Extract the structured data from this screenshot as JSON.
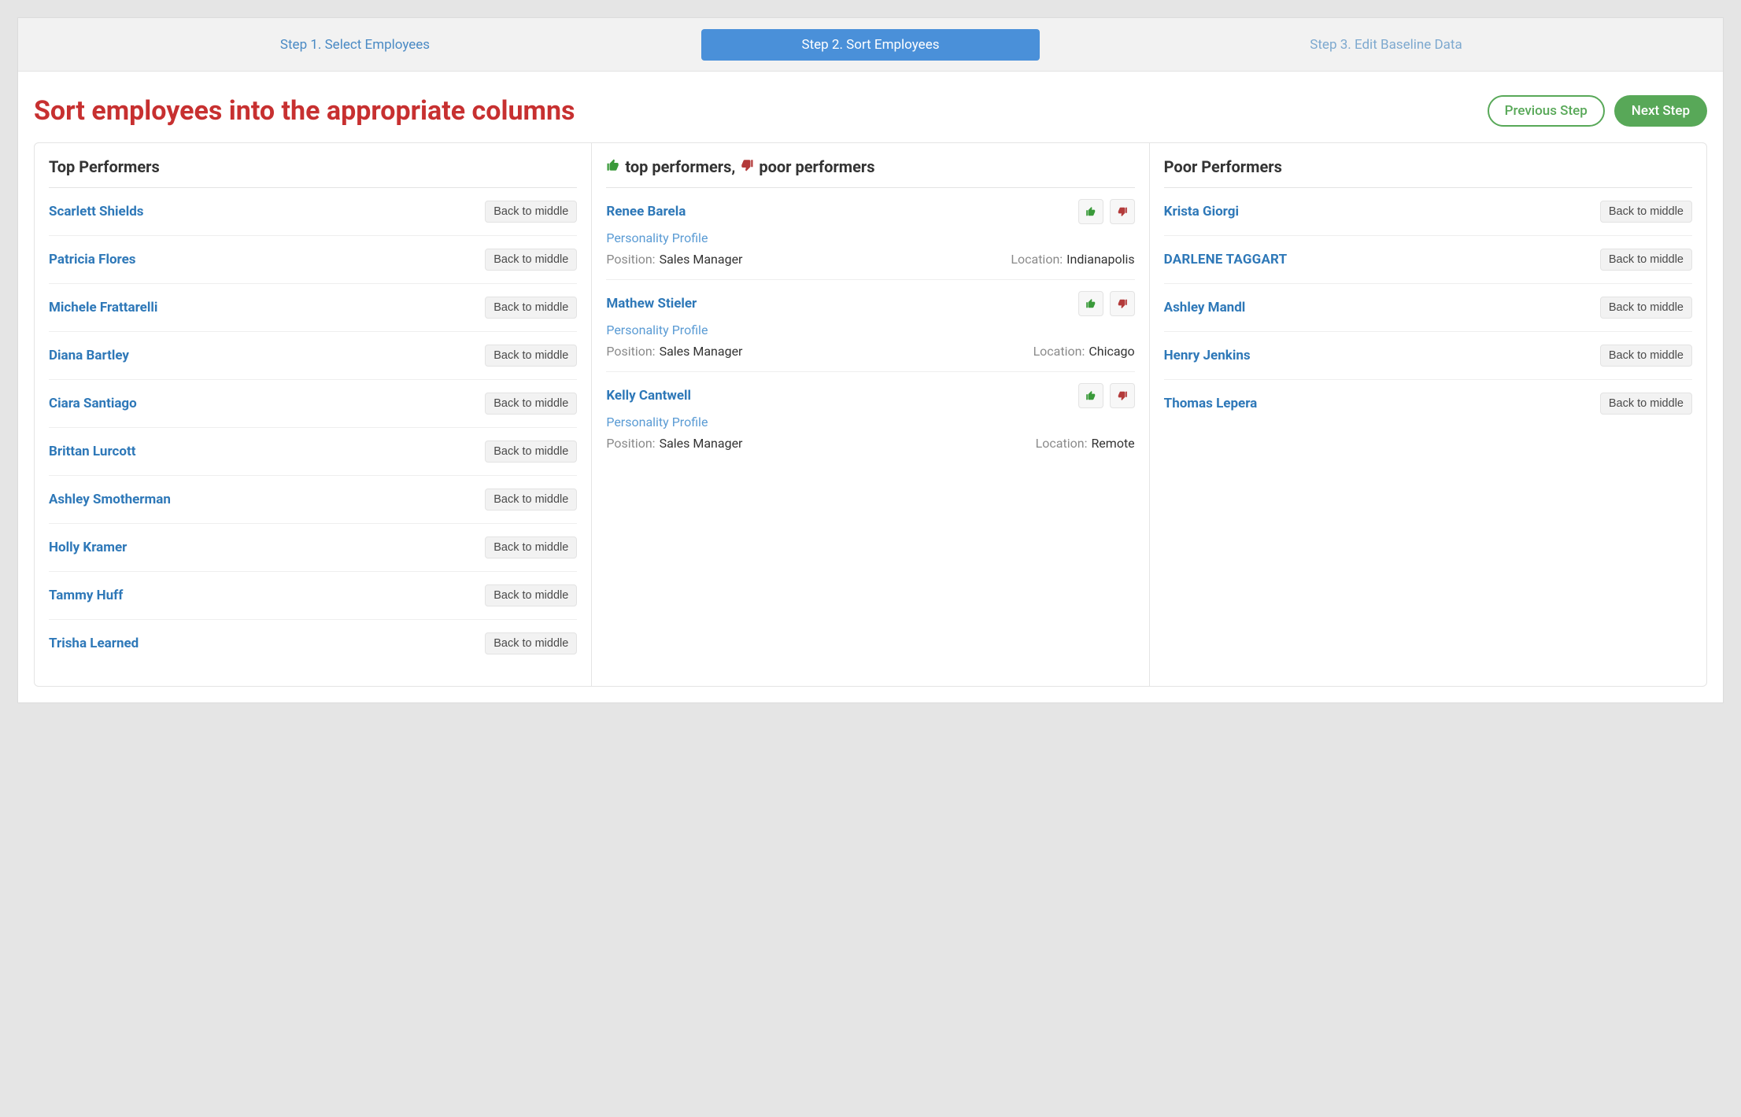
{
  "stepper": {
    "steps": [
      {
        "label": "Step 1. Select Employees",
        "active": false
      },
      {
        "label": "Step 2. Sort Employees",
        "active": true
      },
      {
        "label": "Step 3. Edit Baseline Data",
        "active": false
      }
    ]
  },
  "header": {
    "title": "Sort employees into the appropriate columns",
    "previous_label": "Previous Step",
    "next_label": "Next Step"
  },
  "columns": {
    "top": {
      "title": "Top Performers",
      "back_label": "Back to middle",
      "items": [
        {
          "name": "Scarlett Shields"
        },
        {
          "name": "Patricia Flores"
        },
        {
          "name": "Michele Frattarelli"
        },
        {
          "name": "Diana Bartley"
        },
        {
          "name": "Ciara Santiago"
        },
        {
          "name": "Brittan Lurcott"
        },
        {
          "name": "Ashley Smotherman"
        },
        {
          "name": "Holly Kramer"
        },
        {
          "name": "Tammy Huff"
        },
        {
          "name": "Trisha Learned"
        }
      ]
    },
    "middle": {
      "title_prefix": "top performers,",
      "title_suffix": "poor performers",
      "profile_link_label": "Personality Profile",
      "position_label": "Position:",
      "location_label": "Location:",
      "items": [
        {
          "name": "Renee Barela",
          "position": "Sales Manager",
          "location": "Indianapolis"
        },
        {
          "name": "Mathew Stieler",
          "position": "Sales Manager",
          "location": "Chicago"
        },
        {
          "name": "Kelly Cantwell",
          "position": "Sales Manager",
          "location": "Remote"
        }
      ]
    },
    "poor": {
      "title": "Poor Performers",
      "back_label": "Back to middle",
      "items": [
        {
          "name": "Krista Giorgi"
        },
        {
          "name": "DARLENE TAGGART",
          "caps": true
        },
        {
          "name": "Ashley Mandl"
        },
        {
          "name": "Henry Jenkins"
        },
        {
          "name": "Thomas Lepera"
        }
      ]
    }
  },
  "icons": {
    "thumb_up": "thumb-up-icon",
    "thumb_down": "thumb-down-icon"
  },
  "colors": {
    "accent_blue": "#4a90d9",
    "accent_green": "#58a858",
    "accent_red": "#c73030"
  }
}
